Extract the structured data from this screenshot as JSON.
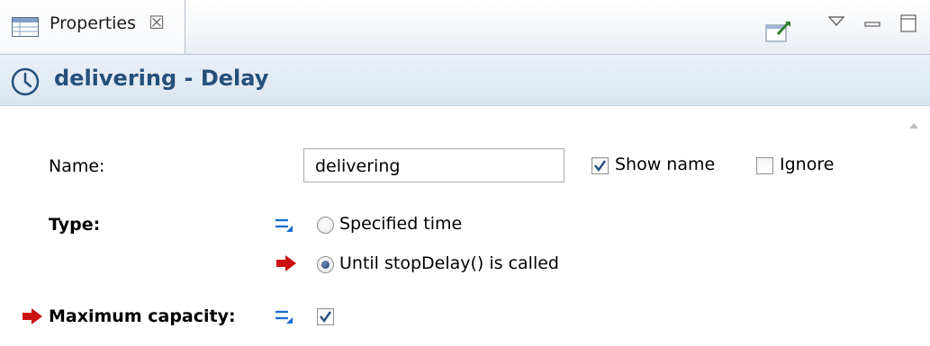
{
  "tab": {
    "label": "Properties",
    "close_glyph": "☒",
    "icon": "properties-table-icon"
  },
  "toolbar": {
    "buttons": [
      "pin-view-icon",
      "view-menu-icon",
      "minimize-icon",
      "maximize-icon"
    ]
  },
  "header": {
    "title": "delivering - Delay",
    "icon": "clock-icon"
  },
  "form": {
    "name_label": "Name:",
    "name_value": "delivering",
    "show_name_label": "Show name",
    "show_name_checked": true,
    "ignore_label": "Ignore",
    "ignore_checked": false,
    "type_label": "Type:",
    "type_options": [
      {
        "label": "Specified time",
        "selected": false
      },
      {
        "label": "Until stopDelay() is called",
        "selected": true
      }
    ],
    "max_capacity_label": "Maximum capacity:",
    "max_capacity_checked": true
  },
  "colors": {
    "title_text": "#264f7a",
    "arrow": "#cc1111",
    "eq_icon": "#1a6fd0"
  }
}
